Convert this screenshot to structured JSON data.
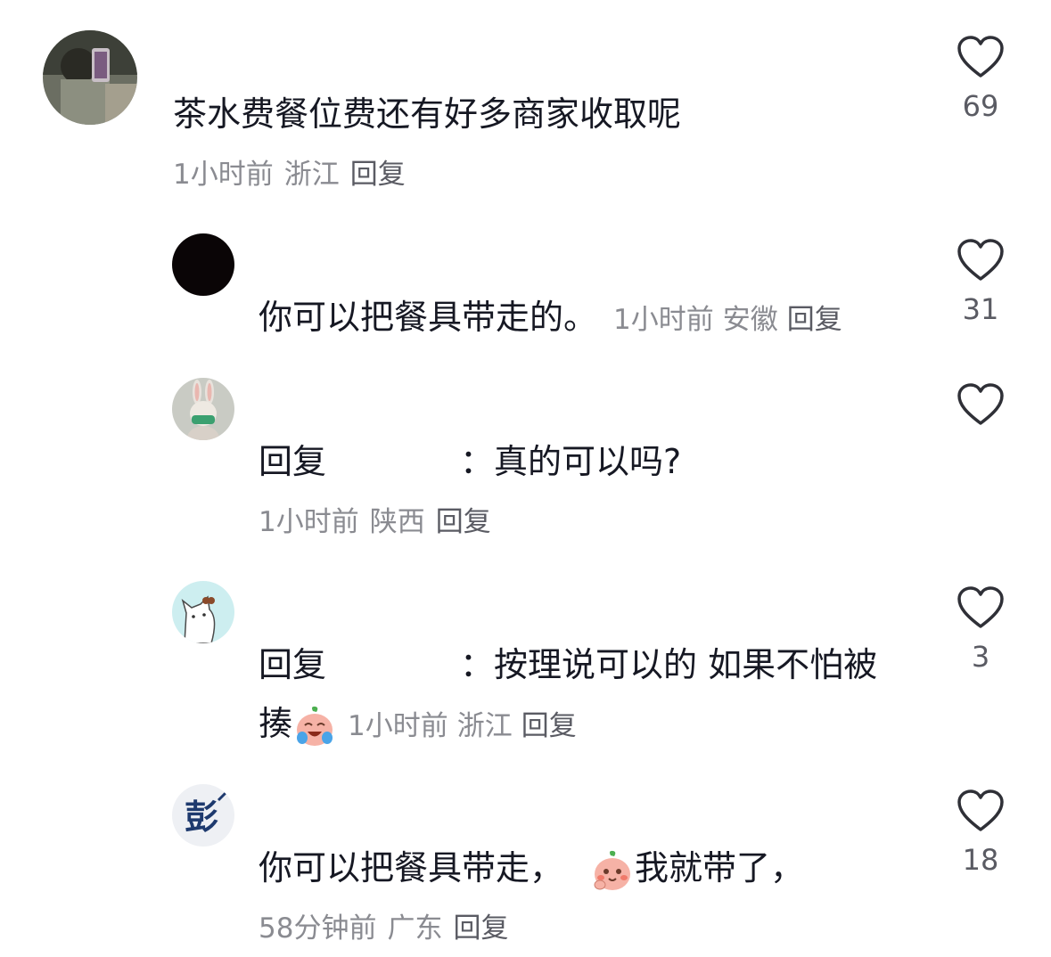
{
  "comments": [
    {
      "avatar": "photo-avatar",
      "text": "茶水费餐位费还有好多商家收取呢",
      "time": "1小时前",
      "location": "浙江",
      "reply_label": "回复",
      "likes": "69"
    },
    {
      "avatar": "black-avatar",
      "text": "你可以把餐具带走的。",
      "time": "1小时前",
      "location": "安徽",
      "reply_label": "回复",
      "likes": "31"
    },
    {
      "avatar": "bunny-avatar",
      "reply_prefix": "回复",
      "text": "：真的可以吗?",
      "time": "1小时前",
      "location": "陕西",
      "reply_label": "回复",
      "likes": ""
    },
    {
      "avatar": "cat-avatar",
      "reply_prefix": "回复",
      "text": "：按理说可以的 如果不怕被",
      "text_line2": "揍",
      "emoji": "crying-laughing-emoji",
      "time": "1小时前",
      "location": "浙江",
      "reply_label": "回复",
      "likes": "3"
    },
    {
      "avatar": "peng-avatar",
      "avatar_text": "彭",
      "text": "你可以把餐具带走，",
      "emoji": "blushing-emoji",
      "text_after": "我就带了，",
      "time": "58分钟前",
      "location": "广东",
      "reply_label": "回复",
      "likes": "18"
    }
  ],
  "colors": {
    "text": "#161823",
    "meta": "#8a8b91",
    "like_outline": "#2f3037"
  }
}
